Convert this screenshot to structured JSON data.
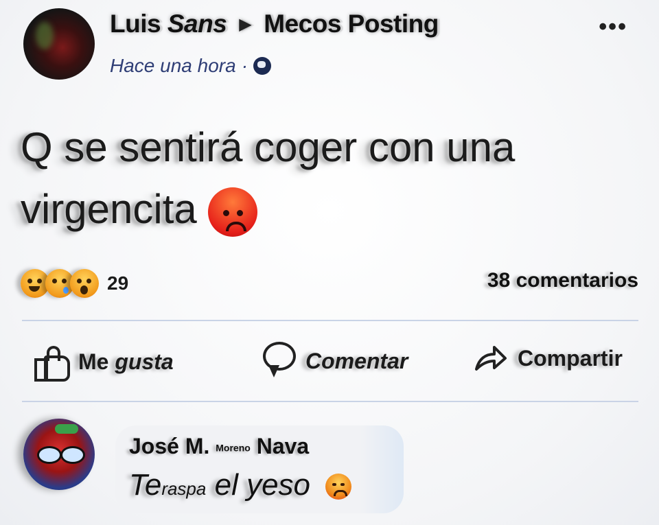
{
  "post": {
    "author": "Luis",
    "author_italic": "Sans",
    "group": "Mecos Posting",
    "timestamp": "Hace una hora",
    "text_line1": "Q se sentirá coger con una",
    "text_line2": "virgencita",
    "inline_emoji": "angry-face-icon"
  },
  "reactions": {
    "icons": [
      "haha-icon",
      "sad-icon",
      "wow-icon"
    ],
    "count": "29"
  },
  "comments_count": "38 comentarios",
  "actions": {
    "like_a": "Me",
    "like_b": "gusta",
    "comment": "Comentar",
    "share": "Compartir"
  },
  "comment": {
    "name_a": "José M.",
    "name_small": "Moreno",
    "name_b": "Nava",
    "text_a": "Te",
    "text_b": "raspa",
    "text_c": "el",
    "text_d": "yeso",
    "emoji": "sad-face-icon"
  },
  "colors": {
    "timestamp": "#2f3e76",
    "divider": "#c9d3e6"
  }
}
